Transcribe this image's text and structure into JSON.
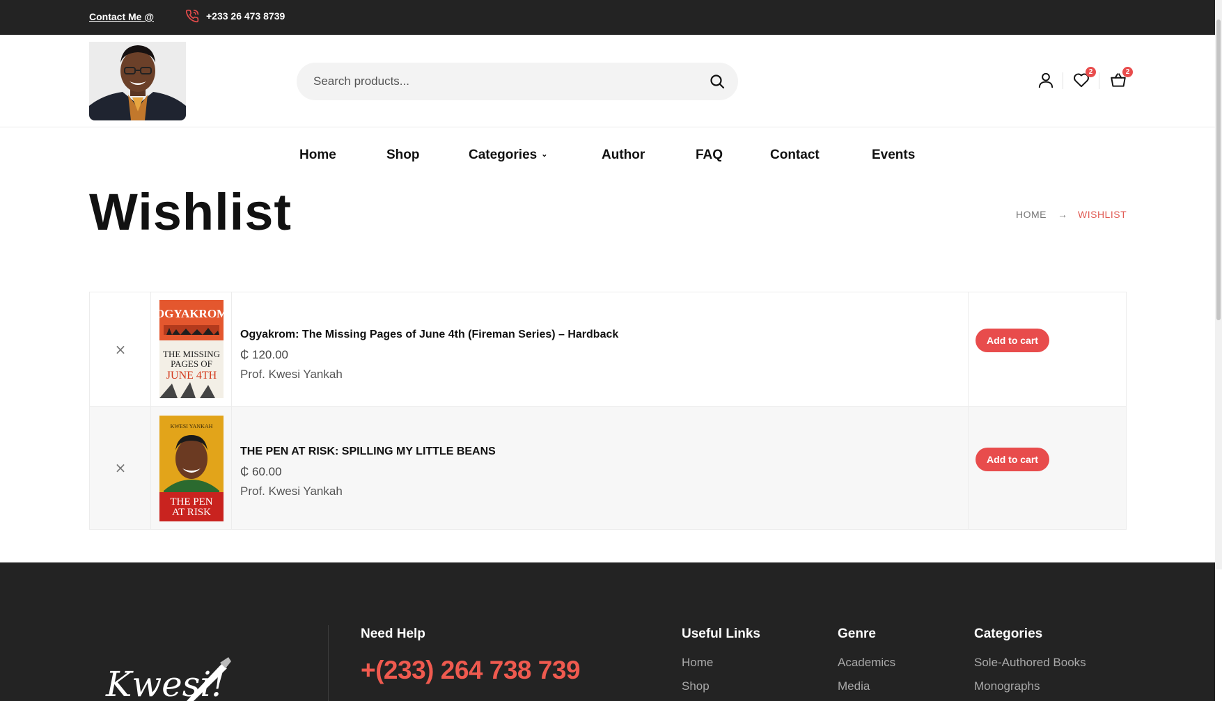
{
  "topbar": {
    "contact_label": "Contact Me @",
    "phone": "+233 26 473 8739"
  },
  "header": {
    "search_placeholder": "Search products...",
    "wishlist_count": "2",
    "cart_count": "2"
  },
  "nav": {
    "items": [
      "Home",
      "Shop",
      "Categories",
      "Author",
      "FAQ",
      "Contact",
      "Events"
    ]
  },
  "page": {
    "title": "Wishlist",
    "breadcrumb_home": "HOME",
    "breadcrumb_current": "WISHLIST"
  },
  "wishlist": {
    "items": [
      {
        "name": "Ogyakrom: The Missing Pages of June 4th (Fireman Series) – Hardback",
        "price": "₵ 120.00",
        "author": "Prof. Kwesi Yankah",
        "action": "Add to cart",
        "cover_title": "OGYAKROM",
        "cover_subtitle_1": "THE MISSING",
        "cover_subtitle_2": "PAGES OF",
        "cover_subtitle_3": "JUNE 4TH"
      },
      {
        "name": "THE PEN AT RISK: SPILLING MY LITTLE BEANS",
        "price": "₵ 60.00",
        "author": "Prof. Kwesi Yankah",
        "action": "Add to cart",
        "cover_author": "KWESI YANKAH",
        "cover_title_1": "THE PEN",
        "cover_title_2": "AT RISK"
      }
    ]
  },
  "footer": {
    "signature": "Kwesi!",
    "need_help_heading": "Need Help",
    "help_phone": "+(233) 264 738 739",
    "useful_links_heading": "Useful Links",
    "useful_links": [
      "Home",
      "Shop"
    ],
    "genre_heading": "Genre",
    "genre_links": [
      "Academics",
      "Media"
    ],
    "categories_heading": "Categories",
    "categories_links": [
      "Sole-Authored Books",
      "Monographs"
    ]
  },
  "colors": {
    "accent": "#e84c4c",
    "dark": "#232323",
    "footer_phone": "#ef5a4f"
  }
}
